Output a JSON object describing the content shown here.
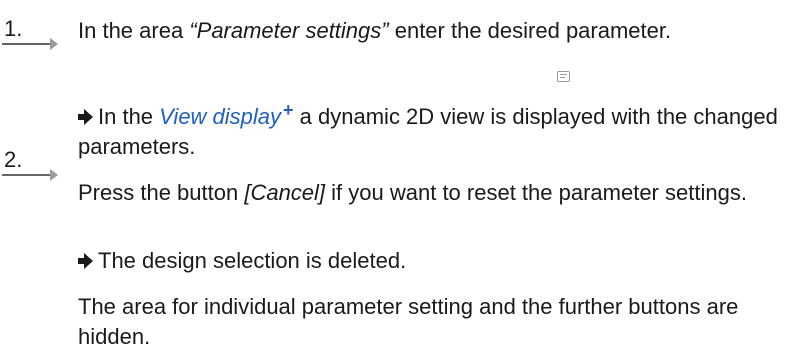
{
  "steps": [
    {
      "number": "1.",
      "text_before": "In the area ",
      "emphasis": "“Parameter settings”",
      "text_after": " enter the desired parameter.",
      "result": {
        "before": "In the ",
        "link": "View display",
        "link_marker": "+",
        "after": " a dynamic 2D view is displayed with the changed parameters."
      }
    },
    {
      "number": "2.",
      "text_before": "Press the button ",
      "emphasis": "[Cancel]",
      "text_after": " if you want to reset the parameter settings.",
      "result": {
        "line1": "The design selection is deleted.",
        "line2": "The area for individual parameter setting and the further buttons are hidden."
      }
    }
  ],
  "icons": {
    "step_arrow": "step-arrow-icon",
    "result_arrow": "result-arrow-icon",
    "inline": "note-icon"
  }
}
